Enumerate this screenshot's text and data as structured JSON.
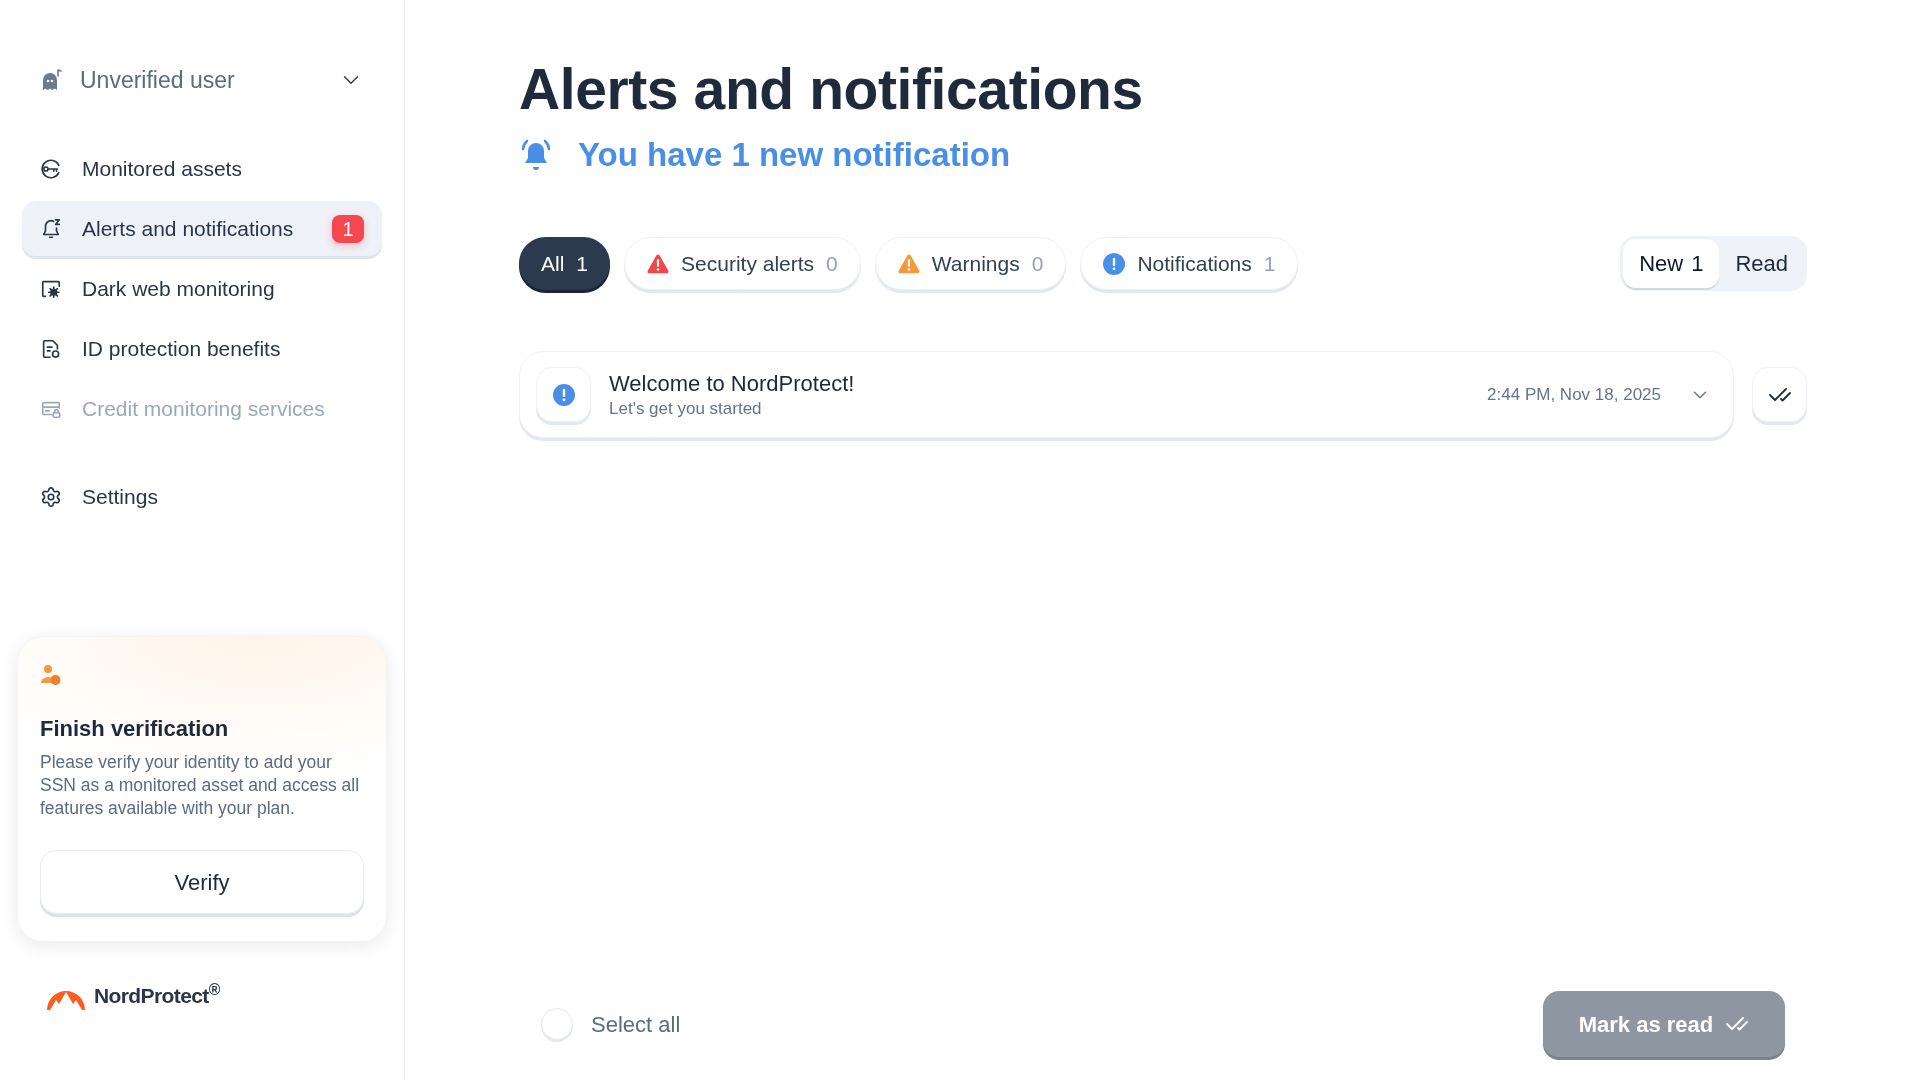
{
  "sidebar": {
    "user_menu": {
      "label": "Unverified user",
      "expanded": false
    },
    "nav_items": [
      {
        "label": "Monitored assets",
        "selected": false,
        "disabled": false
      },
      {
        "label": "Alerts and notifications",
        "selected": true,
        "disabled": false,
        "badge": "1"
      },
      {
        "label": "Dark web monitoring",
        "selected": false,
        "disabled": false
      },
      {
        "label": "ID protection benefits",
        "selected": false,
        "disabled": false
      },
      {
        "label": "Credit monitoring services",
        "selected": false,
        "disabled": true
      }
    ],
    "settings": {
      "label": "Settings",
      "selected": false
    },
    "verification_card": {
      "title": "Finish verification",
      "text": "Please verify your identity to add your SSN as a monitored asset and access all features available with your plan.",
      "button": "Verify"
    },
    "brand": {
      "name": "NordProtect$^{®}$"
    }
  },
  "main": {
    "title": "Alerts and notifications",
    "subtitle": "You have 1 new notification",
    "filters": [
      {
        "kind": "all",
        "label": "All",
        "count": "1",
        "selected": true
      },
      {
        "kind": "security",
        "label": "Security alerts",
        "count": "0",
        "selected": false
      },
      {
        "kind": "warning",
        "label": "Warnings",
        "count": "0",
        "selected": false
      },
      {
        "kind": "info",
        "label": "Notifications",
        "count": "1",
        "selected": false
      }
    ],
    "status_tabs": [
      {
        "label": "New",
        "count": "1",
        "selected": true
      },
      {
        "label": "Read",
        "selected": false
      }
    ],
    "notifications": [
      {
        "kind": "info",
        "title": "Welcome to NordProtect!",
        "subtitle": "Let's get you started",
        "time": "2:44 PM, Nov 18, 2025",
        "expanded": false
      }
    ],
    "select_all": {
      "label": "Select all",
      "checked": false
    },
    "mark_as_read": {
      "label": "Mark as read",
      "disabled": true
    }
  }
}
